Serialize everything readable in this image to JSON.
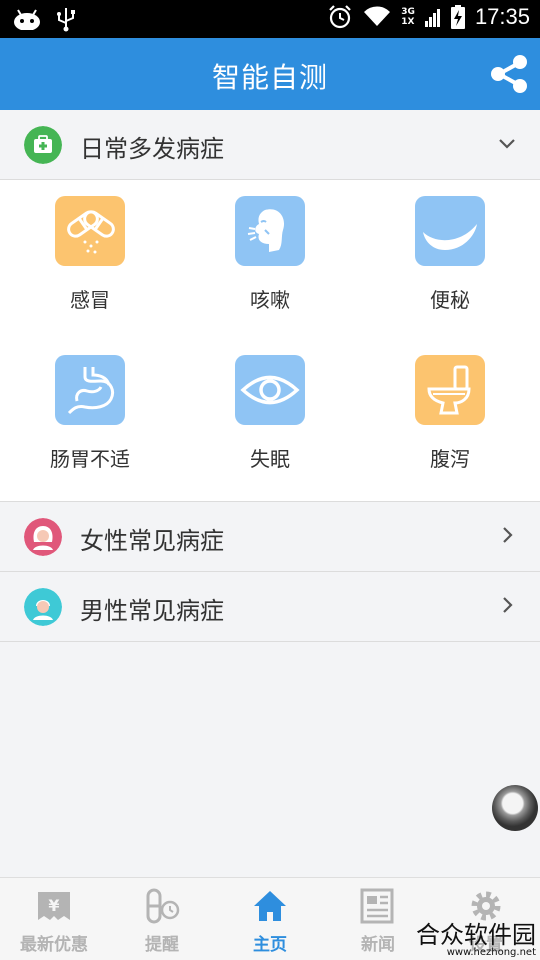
{
  "status_bar": {
    "time": "17:35",
    "network": [
      "3G",
      "1X"
    ]
  },
  "header": {
    "title": "智能自测"
  },
  "sections": {
    "common": {
      "label": "日常多发病症"
    },
    "female": {
      "label": "女性常见病症"
    },
    "male": {
      "label": "男性常见病症"
    }
  },
  "symptoms": [
    {
      "label": "感冒",
      "icon": "pill-capsule-icon"
    },
    {
      "label": "咳嗽",
      "icon": "cough-face-icon"
    },
    {
      "label": "便秘",
      "icon": "banana-icon"
    },
    {
      "label": "肠胃不适",
      "icon": "stomach-icon"
    },
    {
      "label": "失眠",
      "icon": "eye-icon"
    },
    {
      "label": "腹泻",
      "icon": "toilet-icon"
    }
  ],
  "tabs": [
    {
      "label": "最新优惠",
      "icon": "coupon-icon"
    },
    {
      "label": "提醒",
      "icon": "reminder-icon"
    },
    {
      "label": "主页",
      "icon": "home-icon"
    },
    {
      "label": "新闻",
      "icon": "news-icon"
    },
    {
      "label": "设置",
      "icon": "gear-icon"
    }
  ],
  "active_tab": "主页",
  "watermark": {
    "name": "合众软件园",
    "url": "www.hezhong.net"
  },
  "colors": {
    "accent": "#2e8ede",
    "badge_green": "#45b554",
    "badge_pink": "#e0577a",
    "badge_teal": "#3ec9d6",
    "tile_blue": "#8fc4f4",
    "tile_orange": "#fcc46f"
  }
}
